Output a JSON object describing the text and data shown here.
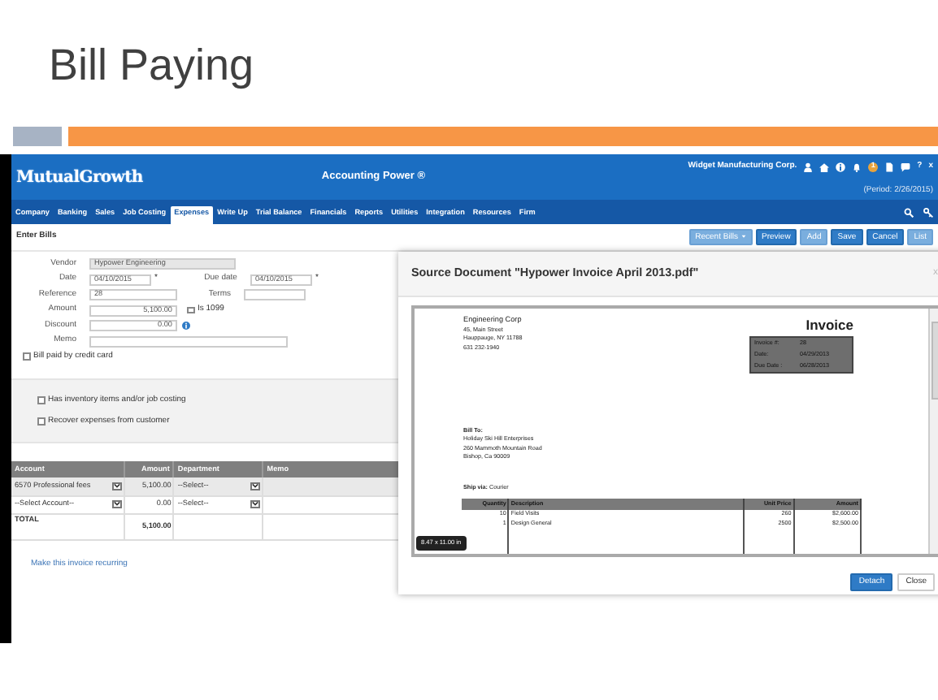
{
  "slide": {
    "title": "Bill Paying"
  },
  "app": {
    "logo": "MutualGrowth",
    "app_name": "Accounting Power ®",
    "company": "Widget Manufacturing Corp.",
    "notification_count": "1",
    "help": "?",
    "close": "x",
    "period": "(Period: 2/26/2015)",
    "nav": [
      {
        "label": "Company",
        "selected": false
      },
      {
        "label": "Banking",
        "selected": false
      },
      {
        "label": "Sales",
        "selected": false
      },
      {
        "label": "Job Costing",
        "selected": false
      },
      {
        "label": "Expenses",
        "selected": true
      },
      {
        "label": "Write Up",
        "selected": false
      },
      {
        "label": "Trial Balance",
        "selected": false
      },
      {
        "label": "Financials",
        "selected": false
      },
      {
        "label": "Reports",
        "selected": false
      },
      {
        "label": "Utilities",
        "selected": false
      },
      {
        "label": "Integration",
        "selected": false
      },
      {
        "label": "Resources",
        "selected": false
      },
      {
        "label": "Firm",
        "selected": false
      }
    ],
    "page_title": "Enter Bills",
    "toolbar": [
      {
        "label": "Recent Bills",
        "kind": "dropdown",
        "disabled": true
      },
      {
        "label": "Preview",
        "kind": "button",
        "disabled": false
      },
      {
        "label": "Add",
        "kind": "button",
        "disabled": true
      },
      {
        "label": "Save",
        "kind": "button",
        "disabled": false
      },
      {
        "label": "Cancel",
        "kind": "button",
        "disabled": false
      },
      {
        "label": "List",
        "kind": "button",
        "disabled": true
      }
    ],
    "form": {
      "vendor": {
        "label": "Vendor",
        "value": "Hypower Engineering",
        "disabled": true
      },
      "date": {
        "label": "Date",
        "value": "04/10/2015",
        "mark": "*"
      },
      "due_date": {
        "label": "Due date",
        "value": "04/10/2015",
        "mark": "*"
      },
      "reference": {
        "label": "Reference",
        "value": "28"
      },
      "terms": {
        "label": "Terms"
      },
      "amount": {
        "label": "Amount",
        "value": "5,100.00"
      },
      "is_1099": {
        "label": "Is 1099",
        "checked": false
      },
      "discount": {
        "label": "Discount",
        "value": "0.00"
      },
      "memo": {
        "label": "Memo"
      },
      "credit_card": {
        "label": "Bill paid by credit card",
        "checked": false
      }
    },
    "options": [
      {
        "label": "Has inventory items and/or job costing",
        "checked": false
      },
      {
        "label": "Recover expenses from customer",
        "checked": false
      }
    ],
    "lines": {
      "columns": [
        "Account",
        "Amount",
        "Department",
        "Memo"
      ],
      "rows": [
        {
          "account": "6570 Professional fees",
          "amount": "5,100.00",
          "department": "--Select--",
          "selected": true
        },
        {
          "account": "--Select Account--",
          "amount": "0.00",
          "department": "--Select--",
          "selected": false
        }
      ],
      "total": {
        "label": "TOTAL",
        "amount": "5,100.00"
      }
    },
    "recurring_link": "Make this invoice recurring"
  },
  "modal": {
    "title": "Source Document \"Hypower Invoice April 2013.pdf\"",
    "close": "x",
    "document": {
      "sender": [
        "Engineering Corp",
        "45, Main Street",
        "Hauppauge, NY 11788",
        "631 232-1940"
      ],
      "heading": "Invoice",
      "info": [
        [
          "Invoice #:",
          "28"
        ],
        [
          "Date:",
          "04/29/2013"
        ],
        [
          "Due Date :",
          "06/28/2013"
        ]
      ],
      "bill_to_label": "Bill To:",
      "bill_to": [
        "Holiday Ski Hill Enterprises",
        "260 Mammoth Mountain Road",
        "Bishop, Ca 90009"
      ],
      "ship_via": "**Ship via:** Courier",
      "columns": [
        "Quantity",
        "Description",
        "Unit Price",
        "Amount"
      ],
      "rows": [
        [
          "10",
          "Field Visits",
          "260",
          "$2,600.00"
        ],
        [
          "1",
          "Design General",
          "2500",
          "$2,500.00"
        ]
      ]
    },
    "size": "8.47 x 11.00 in",
    "buttons": [
      {
        "label": "Detach",
        "primary": true
      },
      {
        "label": "Close",
        "primary": false
      }
    ]
  }
}
